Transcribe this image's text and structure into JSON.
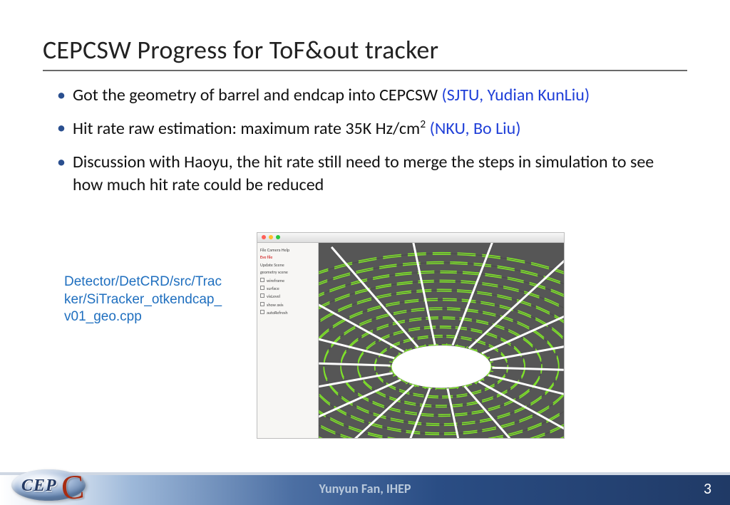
{
  "slide": {
    "title": "CEPCSW Progress for ToF&out tracker",
    "bullets": [
      {
        "text": "Got the geometry of barrel and endcap into CEPCSW ",
        "credit": "(SJTU, Yudian KunLiu)"
      },
      {
        "text_pre": "Hit rate raw estimation: maximum rate 35K Hz/cm",
        "sup": "2",
        "text_post": "  ",
        "credit": "(NKU, Bo Liu)"
      },
      {
        "text": "Discussion with Haoyu, the hit rate still need to merge the steps in simulation to see how much hit rate could be reduced"
      }
    ],
    "code_path": "Detector/DetCRD/src/Tracker/SiTracker_otkendcap_v01_geo.cpp",
    "figure": {
      "sidebar_lines": [
        "File   Camera   Help",
        "Eve file",
        "Update Scene",
        "geometry scene"
      ],
      "sidebar_checks": [
        "wireframe",
        "surface",
        "visLevel",
        "show axis",
        "autoRefresh"
      ]
    },
    "footer": {
      "author": "Yunyun Fan, IHEP",
      "page": "3",
      "logo_text": "CEP",
      "logo_c": "C"
    }
  }
}
